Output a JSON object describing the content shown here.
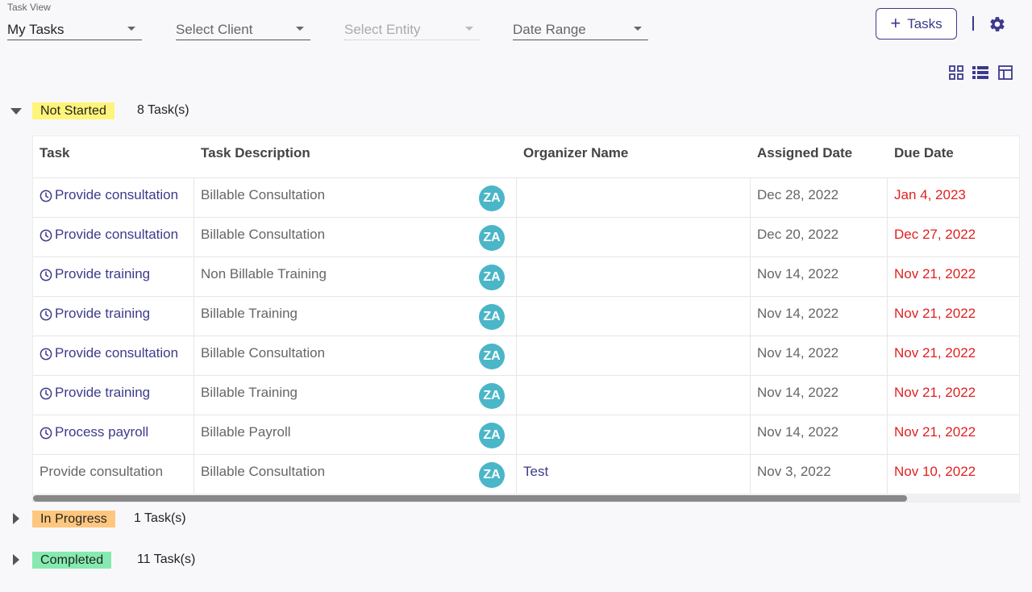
{
  "filters": {
    "task_view": {
      "label": "Task View",
      "value": "My Tasks"
    },
    "client": {
      "placeholder": "Select Client"
    },
    "entity": {
      "placeholder": "Select Entity"
    },
    "date_range": {
      "placeholder": "Date Range"
    }
  },
  "toolbar": {
    "add_tasks_label": "Tasks",
    "separator": "|"
  },
  "icons": {
    "add": "plus-icon",
    "settings": "gear-icon",
    "views": [
      "grid-view-icon",
      "list-view-icon",
      "table-view-icon"
    ],
    "task_status": "clock-icon"
  },
  "colors": {
    "accent": "#3d3a8c",
    "avatar": "#4ab6c8",
    "overdue": "#e02020",
    "not_started": "#fff47a",
    "in_progress": "#ffc77e",
    "completed": "#86eab0"
  },
  "groups": [
    {
      "status": "Not Started",
      "count": "8 Task(s)",
      "expanded": true
    },
    {
      "status": "In Progress",
      "count": "1 Task(s)",
      "expanded": false
    },
    {
      "status": "Completed",
      "count": "11 Task(s)",
      "expanded": false
    }
  ],
  "table": {
    "columns": [
      "Task",
      "Task Description",
      "Organizer Name",
      "Assigned Date",
      "Due Date"
    ],
    "rows": [
      {
        "task": "Provide consultation",
        "linked": true,
        "description": "Billable Consultation",
        "avatar": "ZA",
        "organizer": "",
        "assigned": "Dec 28, 2022",
        "due": "Jan 4, 2023"
      },
      {
        "task": "Provide consultation",
        "linked": true,
        "description": "Billable Consultation",
        "avatar": "ZA",
        "organizer": "",
        "assigned": "Dec 20, 2022",
        "due": "Dec 27, 2022"
      },
      {
        "task": "Provide training",
        "linked": true,
        "description": "Non Billable Training",
        "avatar": "ZA",
        "organizer": "",
        "assigned": "Nov 14, 2022",
        "due": "Nov 21, 2022"
      },
      {
        "task": "Provide training",
        "linked": true,
        "description": "Billable Training",
        "avatar": "ZA",
        "organizer": "",
        "assigned": "Nov 14, 2022",
        "due": "Nov 21, 2022"
      },
      {
        "task": "Provide consultation",
        "linked": true,
        "description": "Billable Consultation",
        "avatar": "ZA",
        "organizer": "",
        "assigned": "Nov 14, 2022",
        "due": "Nov 21, 2022"
      },
      {
        "task": "Provide training",
        "linked": true,
        "description": "Billable Training",
        "avatar": "ZA",
        "organizer": "",
        "assigned": "Nov 14, 2022",
        "due": "Nov 21, 2022"
      },
      {
        "task": "Process payroll",
        "linked": true,
        "description": "Billable Payroll",
        "avatar": "ZA",
        "organizer": "",
        "assigned": "Nov 14, 2022",
        "due": "Nov 21, 2022"
      },
      {
        "task": "Provide consultation",
        "linked": false,
        "description": "Billable Consultation",
        "avatar": "ZA",
        "organizer": "Test",
        "assigned": "Nov 3, 2022",
        "due": "Nov 10, 2022"
      }
    ]
  }
}
